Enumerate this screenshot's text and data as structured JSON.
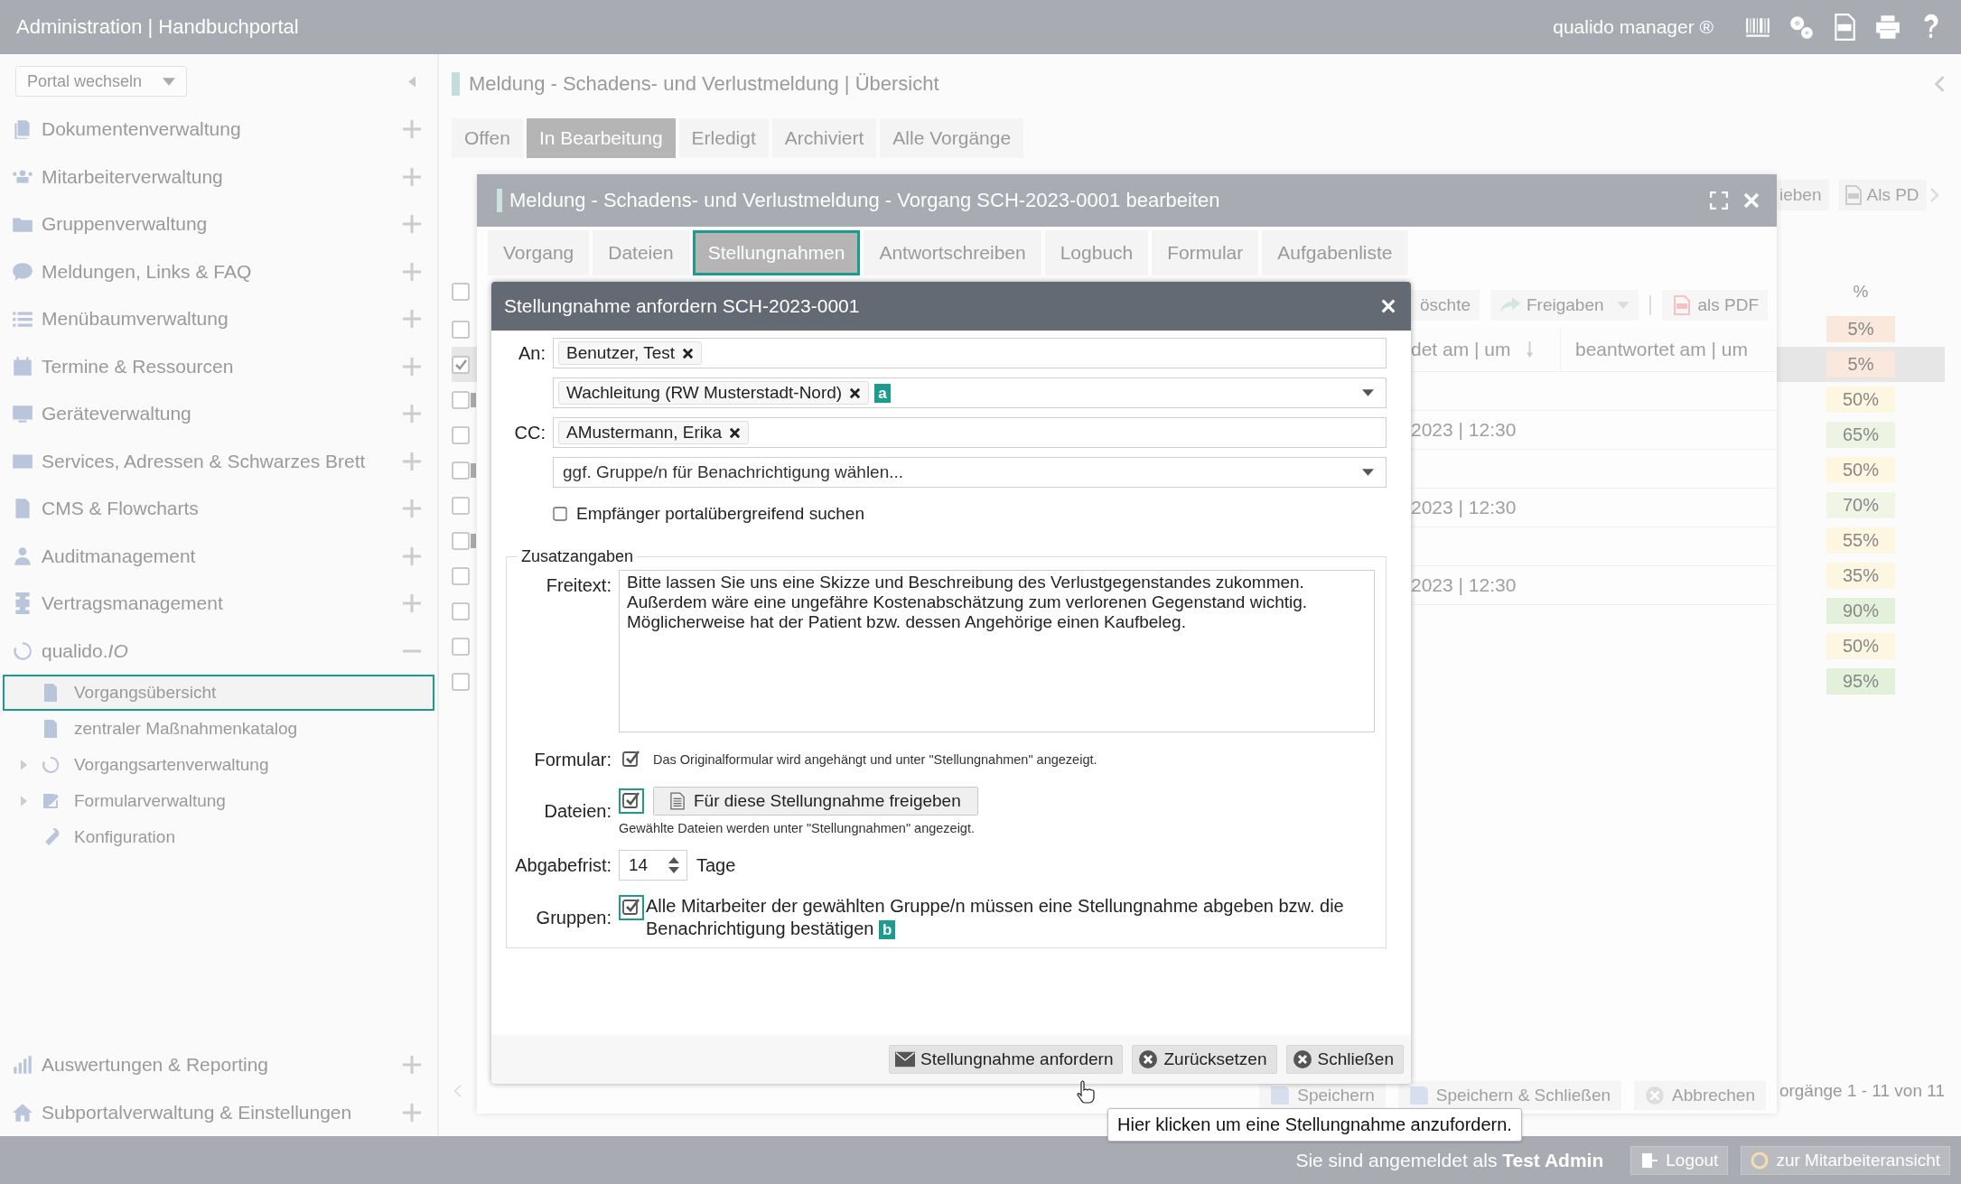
{
  "app_bar": {
    "title": "Administration | Handbuchportal",
    "product": "qualido manager ®"
  },
  "sidebar": {
    "portal_switch": "Portal wechseln",
    "items": [
      {
        "label": "Dokumentenverwaltung",
        "expanded": false
      },
      {
        "label": "Mitarbeiterverwaltung",
        "expanded": false
      },
      {
        "label": "Gruppenverwaltung",
        "expanded": false
      },
      {
        "label": "Meldungen, Links & FAQ",
        "expanded": false
      },
      {
        "label": "Menübaumverwaltung",
        "expanded": false
      },
      {
        "label": "Termine & Ressourcen",
        "expanded": false
      },
      {
        "label": "Geräteverwaltung",
        "expanded": false
      },
      {
        "label": "Services, Adressen & Schwarzes Brett",
        "expanded": false
      },
      {
        "label": "CMS & Flowcharts",
        "expanded": false
      },
      {
        "label": "Auditmanagement",
        "expanded": false
      },
      {
        "label": "Vertragsmanagement",
        "expanded": false
      },
      {
        "label": "qualido.*IO*",
        "expanded": true,
        "children": [
          {
            "label": "Vorgangsübersicht",
            "selected": true,
            "expandable": false
          },
          {
            "label": "zentraler Maßnahmenkatalog",
            "selected": false,
            "expandable": false
          },
          {
            "label": "Vorgangsartenverwaltung",
            "selected": false,
            "expandable": true
          },
          {
            "label": "Formularverwaltung",
            "selected": false,
            "expandable": true
          },
          {
            "label": "Konfiguration",
            "selected": false,
            "expandable": false
          }
        ]
      }
    ],
    "bottom_items": [
      {
        "label": "Auswertungen & Reporting",
        "expanded": false
      },
      {
        "label": "Subportalverwaltung & Einstellungen",
        "expanded": false
      }
    ]
  },
  "page": {
    "title": "Meldung - Schadens- und Verlustmeldung | Übersicht",
    "tabs": [
      {
        "label": "Offen",
        "selected": false
      },
      {
        "label": "In Bearbeitung",
        "selected": true
      },
      {
        "label": "Erledigt",
        "selected": false
      },
      {
        "label": "Archiviert",
        "selected": false
      },
      {
        "label": "Alle Vorgänge",
        "selected": false
      }
    ],
    "toolbar": [
      {
        "label": "ieben",
        "kind": "plain"
      },
      {
        "label": "Als PD",
        "kind": "pdf"
      }
    ],
    "table": {
      "select_all_checked": false,
      "percent_header": "%",
      "rows": [
        {
          "checked": false,
          "selected": false,
          "group": false,
          "percent": "5%",
          "color": "#fbe8dd"
        },
        {
          "checked": true,
          "selected": true,
          "group": false,
          "percent": "5%",
          "color": "#fbe8dd"
        },
        {
          "checked": false,
          "selected": false,
          "group": true,
          "percent": "50%",
          "color": "#fdf6e0"
        },
        {
          "checked": false,
          "selected": false,
          "group": false,
          "percent": "65%",
          "color": "#eef4e3"
        },
        {
          "checked": false,
          "selected": false,
          "group": true,
          "percent": "50%",
          "color": "#fdf6e0"
        },
        {
          "checked": false,
          "selected": false,
          "group": false,
          "percent": "70%",
          "color": "#f1f5e6"
        },
        {
          "checked": false,
          "selected": false,
          "group": true,
          "percent": "55%",
          "color": "#fdf6e0"
        },
        {
          "checked": false,
          "selected": false,
          "group": false,
          "percent": "35%",
          "color": "#fdf6e0"
        },
        {
          "checked": false,
          "selected": false,
          "group": false,
          "percent": "90%",
          "color": "#e3f0da"
        },
        {
          "checked": false,
          "selected": false,
          "group": false,
          "percent": "50%",
          "color": "#fdf6e0"
        },
        {
          "checked": false,
          "selected": false,
          "group": false,
          "percent": "95%",
          "color": "#e3f0da"
        }
      ]
    },
    "footer": "orgänge 1 - 11 von 11"
  },
  "record_dialog": {
    "title": "Meldung - Schadens- und Verlustmeldung - Vorgang SCH-2023-0001 bearbeiten",
    "tabs": [
      {
        "label": "Vorgang",
        "selected": false
      },
      {
        "label": "Dateien",
        "selected": false
      },
      {
        "label": "Stellungnahmen",
        "selected": true
      },
      {
        "label": "Antwortschreiben",
        "selected": false
      },
      {
        "label": "Logbuch",
        "selected": false
      },
      {
        "label": "Formular",
        "selected": false
      },
      {
        "label": "Aufgabenliste",
        "selected": false
      }
    ],
    "toolbar": [
      {
        "label": "öschte",
        "kind": "plain"
      },
      {
        "label": "Freigaben",
        "kind": "share"
      },
      {
        "label": "als PDF",
        "kind": "pdf"
      }
    ],
    "columns": [
      "det am | um",
      "beantwortet am | um"
    ],
    "rows": [
      {
        "kind": "empty"
      },
      {
        "kind": "dated",
        "sent": "2023 | 12:30"
      },
      {
        "kind": "empty"
      },
      {
        "kind": "dated",
        "sent": "2023 | 12:30"
      },
      {
        "kind": "empty"
      },
      {
        "kind": "dated",
        "sent": "2023 | 12:30"
      }
    ],
    "buttons": [
      {
        "label": "Speichern",
        "kind": "save"
      },
      {
        "label": "Speichern & Schließen",
        "kind": "save"
      },
      {
        "label": "Abbrechen",
        "kind": "cancel"
      }
    ]
  },
  "request_dialog": {
    "title": "Stellungnahme anfordern SCH-2023-0001",
    "to_label": "An:",
    "to": [
      {
        "chips": [
          {
            "label": "Benutzer, Test"
          }
        ],
        "dropdown": false
      },
      {
        "chips": [
          {
            "label": "Wachleitung (RW Musterstadt-Nord)"
          }
        ],
        "marker": "a",
        "dropdown": true
      }
    ],
    "cc_label": "CC:",
    "cc": [
      {
        "label": "AMustermann, Erika"
      }
    ],
    "group_select": {
      "placeholder": "ggf. Gruppe/n für Benachrichtigung wählen..."
    },
    "cross_portal": {
      "label": "Empfänger portalübergreifend suchen",
      "checked": false
    },
    "section": "Zusatzangaben",
    "freetext_label": "Freitext:",
    "freetext": "Bitte lassen Sie uns eine Skizze und Beschreibung des Verlustgegenstandes zukommen. Außerdem wäre eine ungefähre Kostenabschätzung zum verlorenen Gegenstand wichtig. Möglicherweise hat der Patient bzw. dessen Angehörige einen Kaufbeleg.",
    "form": {
      "label": "Formular:",
      "checked": true,
      "highlighted": false,
      "note": "Das Originalformular wird angehängt und unter \"Stellungnahmen\" angezeigt."
    },
    "files": {
      "label": "Dateien:",
      "checked": true,
      "highlighted": true,
      "button": "Für diese Stellungnahme freigeben",
      "note": "Gewählte Dateien werden unter \"Stellungnahmen\" angezeigt."
    },
    "deadline": {
      "label": "Abgabefrist:",
      "value": "14",
      "unit": "Tage"
    },
    "groups": {
      "label": "Gruppen:",
      "checked": true,
      "highlighted": true,
      "text": "Alle Mitarbeiter der gewählten Gruppe/n müssen eine Stellungnahme abgeben bzw. die Benachrichtigung bestätigen",
      "marker": "b"
    },
    "buttons": [
      {
        "label": "Stellungnahme anfordern",
        "kind": "mail"
      },
      {
        "label": "Zurücksetzen",
        "kind": "cancel"
      },
      {
        "label": "Schließen",
        "kind": "cancel"
      }
    ]
  },
  "tooltip": "Hier klicken um eine Stellungnahme anzufordern.",
  "status_bar": {
    "text": "Sie sind angemeldet als **Test Admin**",
    "buttons": [
      {
        "label": "Logout",
        "kind": "logout"
      },
      {
        "label": "zur Mitarbeiteransicht",
        "kind": "switch"
      }
    ]
  }
}
